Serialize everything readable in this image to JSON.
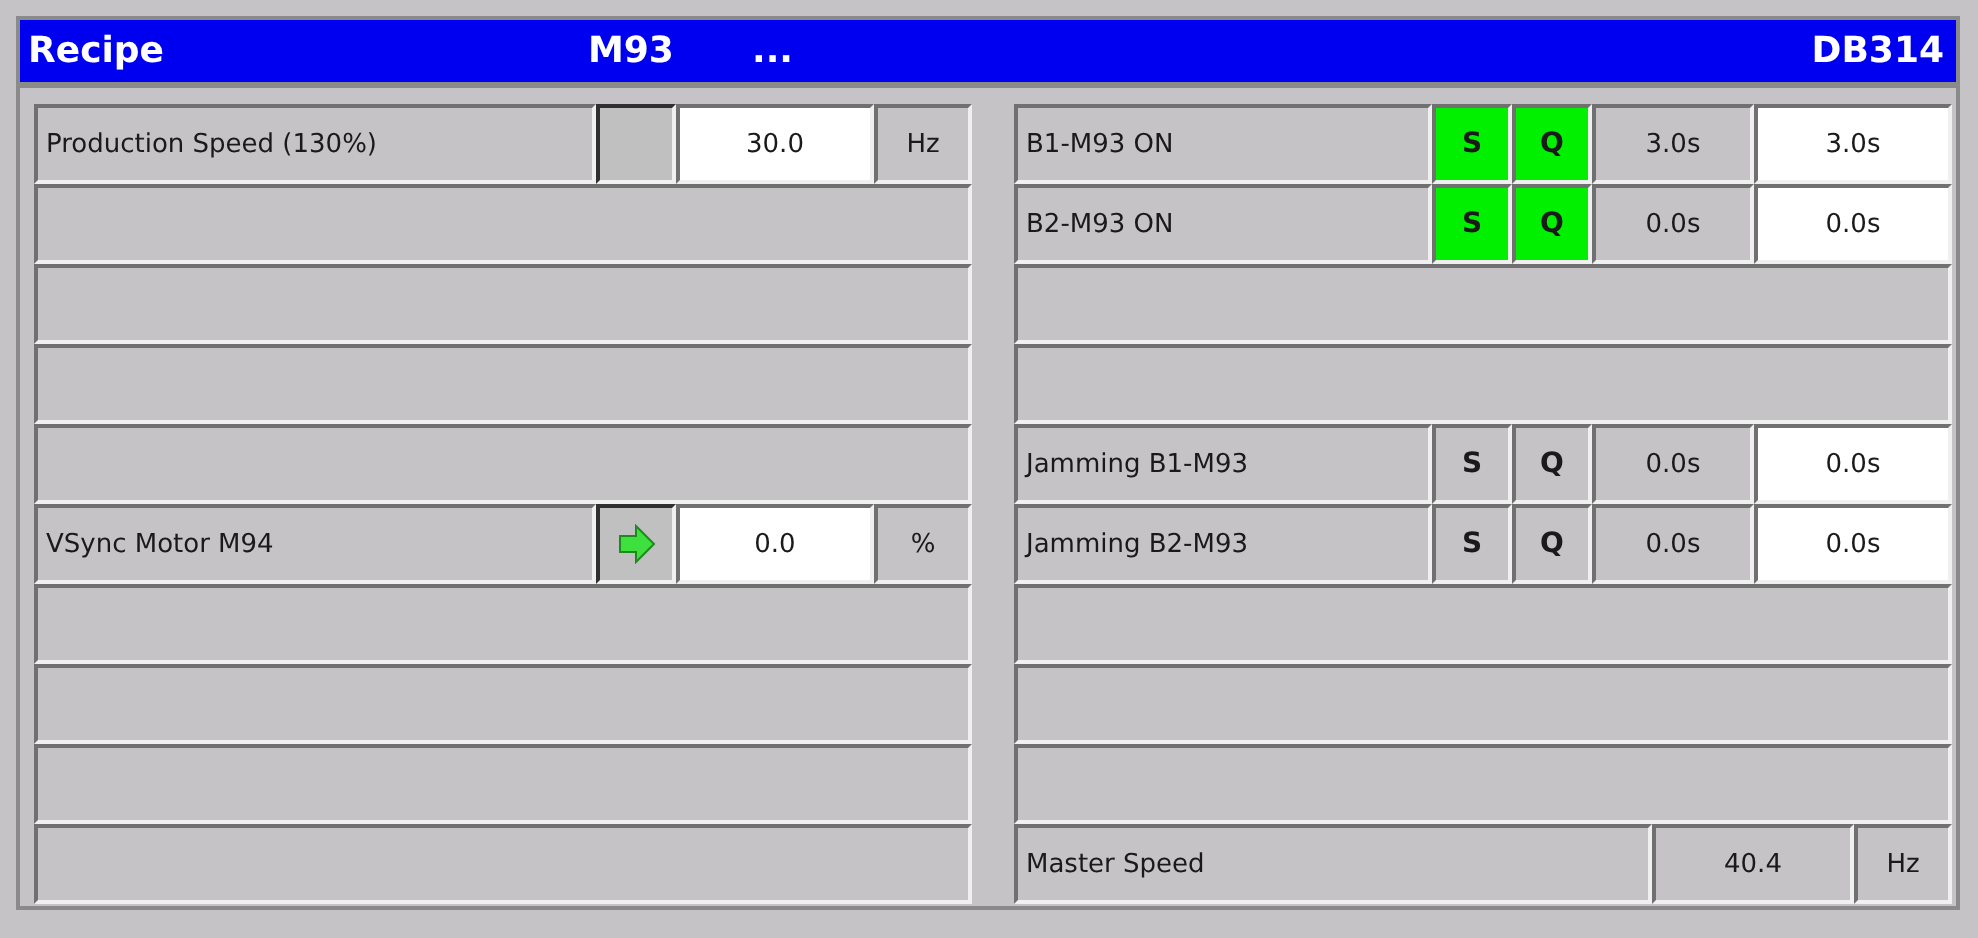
{
  "header": {
    "title": "Recipe",
    "motor": "M93",
    "ellipsis": "...",
    "block": "DB314"
  },
  "left_rows": [
    {
      "kind": "value",
      "label": "Production Speed (130%)",
      "running": false,
      "value": "30.0",
      "unit": "Hz"
    },
    {
      "kind": "empty"
    },
    {
      "kind": "empty"
    },
    {
      "kind": "empty"
    },
    {
      "kind": "empty"
    },
    {
      "kind": "value",
      "label": "VSync Motor M94",
      "running": true,
      "value": "0.0",
      "unit": "%"
    },
    {
      "kind": "empty"
    },
    {
      "kind": "empty"
    },
    {
      "kind": "empty"
    },
    {
      "kind": "empty"
    }
  ],
  "right_rows": [
    {
      "kind": "timer",
      "label": "B1-M93 ON",
      "s": {
        "text": "S",
        "active": true
      },
      "q": {
        "text": "Q",
        "active": true
      },
      "actual": "3.0s",
      "setpoint": "3.0s"
    },
    {
      "kind": "timer",
      "label": "B2-M93 ON",
      "s": {
        "text": "S",
        "active": true
      },
      "q": {
        "text": "Q",
        "active": true
      },
      "actual": "0.0s",
      "setpoint": "0.0s"
    },
    {
      "kind": "empty"
    },
    {
      "kind": "empty"
    },
    {
      "kind": "timer",
      "label": "Jamming B1-M93",
      "s": {
        "text": "S",
        "active": false
      },
      "q": {
        "text": "Q",
        "active": false
      },
      "actual": "0.0s",
      "setpoint": "0.0s"
    },
    {
      "kind": "timer",
      "label": "Jamming B2-M93",
      "s": {
        "text": "S",
        "active": false
      },
      "q": {
        "text": "Q",
        "active": false
      },
      "actual": "0.0s",
      "setpoint": "0.0s"
    },
    {
      "kind": "empty"
    },
    {
      "kind": "empty"
    },
    {
      "kind": "empty"
    },
    {
      "kind": "reading",
      "label": "Master Speed",
      "value": "40.4",
      "unit": "Hz"
    }
  ]
}
